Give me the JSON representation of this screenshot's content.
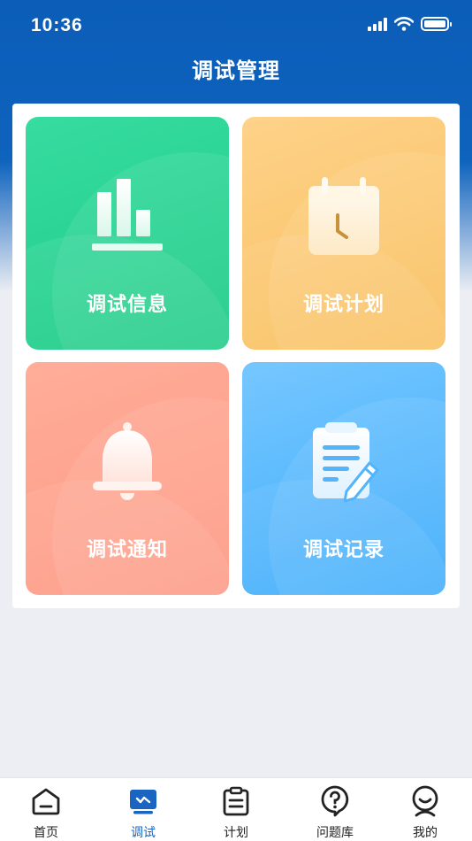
{
  "status_bar": {
    "time": "10:36"
  },
  "header": {
    "title": "调试管理"
  },
  "cards": [
    {
      "label": "调试信息",
      "icon": "bar-chart-icon"
    },
    {
      "label": "调试计划",
      "icon": "calendar-icon"
    },
    {
      "label": "调试通知",
      "icon": "bell-icon"
    },
    {
      "label": "调试记录",
      "icon": "notepad-edit-icon"
    }
  ],
  "tabbar": {
    "active": "调试",
    "items": [
      {
        "label": "首页",
        "icon": "home-icon"
      },
      {
        "label": "调试",
        "icon": "debug-monitor-icon"
      },
      {
        "label": "计划",
        "icon": "clipboard-icon"
      },
      {
        "label": "问题库",
        "icon": "question-icon"
      },
      {
        "label": "我的",
        "icon": "profile-icon"
      }
    ]
  },
  "colors": {
    "header_blue": "#0b5db8",
    "card_green": "#1ccb86",
    "card_yellow": "#f9c05e",
    "card_red": "#fd9a85",
    "card_blue": "#3eacfb",
    "tab_active": "#1a64c2"
  }
}
